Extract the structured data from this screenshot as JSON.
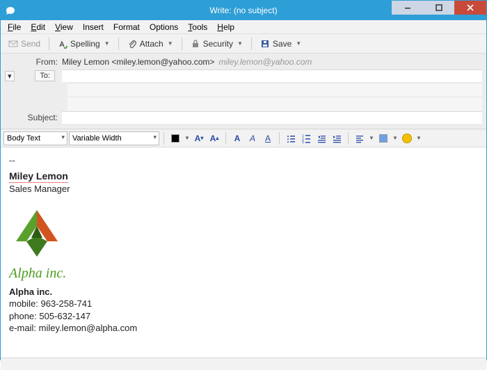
{
  "window": {
    "title": "Write: (no subject)"
  },
  "menu": {
    "file": "File",
    "edit": "Edit",
    "view": "View",
    "insert": "Insert",
    "format": "Format",
    "options": "Options",
    "tools": "Tools",
    "help": "Help"
  },
  "toolbar": {
    "send": "Send",
    "spelling": "Spelling",
    "attach": "Attach",
    "security": "Security",
    "save": "Save"
  },
  "headers": {
    "from_label": "From:",
    "from_value": "Miley Lemon <miley.lemon@yahoo.com>",
    "from_hint": "miley.lemon@yahoo.com",
    "to_label": "To:",
    "to_value": "",
    "subject_label": "Subject:",
    "subject_value": ""
  },
  "format": {
    "para_style": "Body Text",
    "font_family": "Variable Width"
  },
  "signature": {
    "dashes": "--",
    "name": "Miley Lemon",
    "title": "Sales Manager",
    "logo_text": "Alpha inc.",
    "company": "Alpha inc.",
    "mobile_label": "mobile: ",
    "mobile": "963-258-741",
    "phone_label": "phone: ",
    "phone": "505-632-147",
    "email_label": "e-mail: ",
    "email": "miley.lemon@alpha.com"
  }
}
